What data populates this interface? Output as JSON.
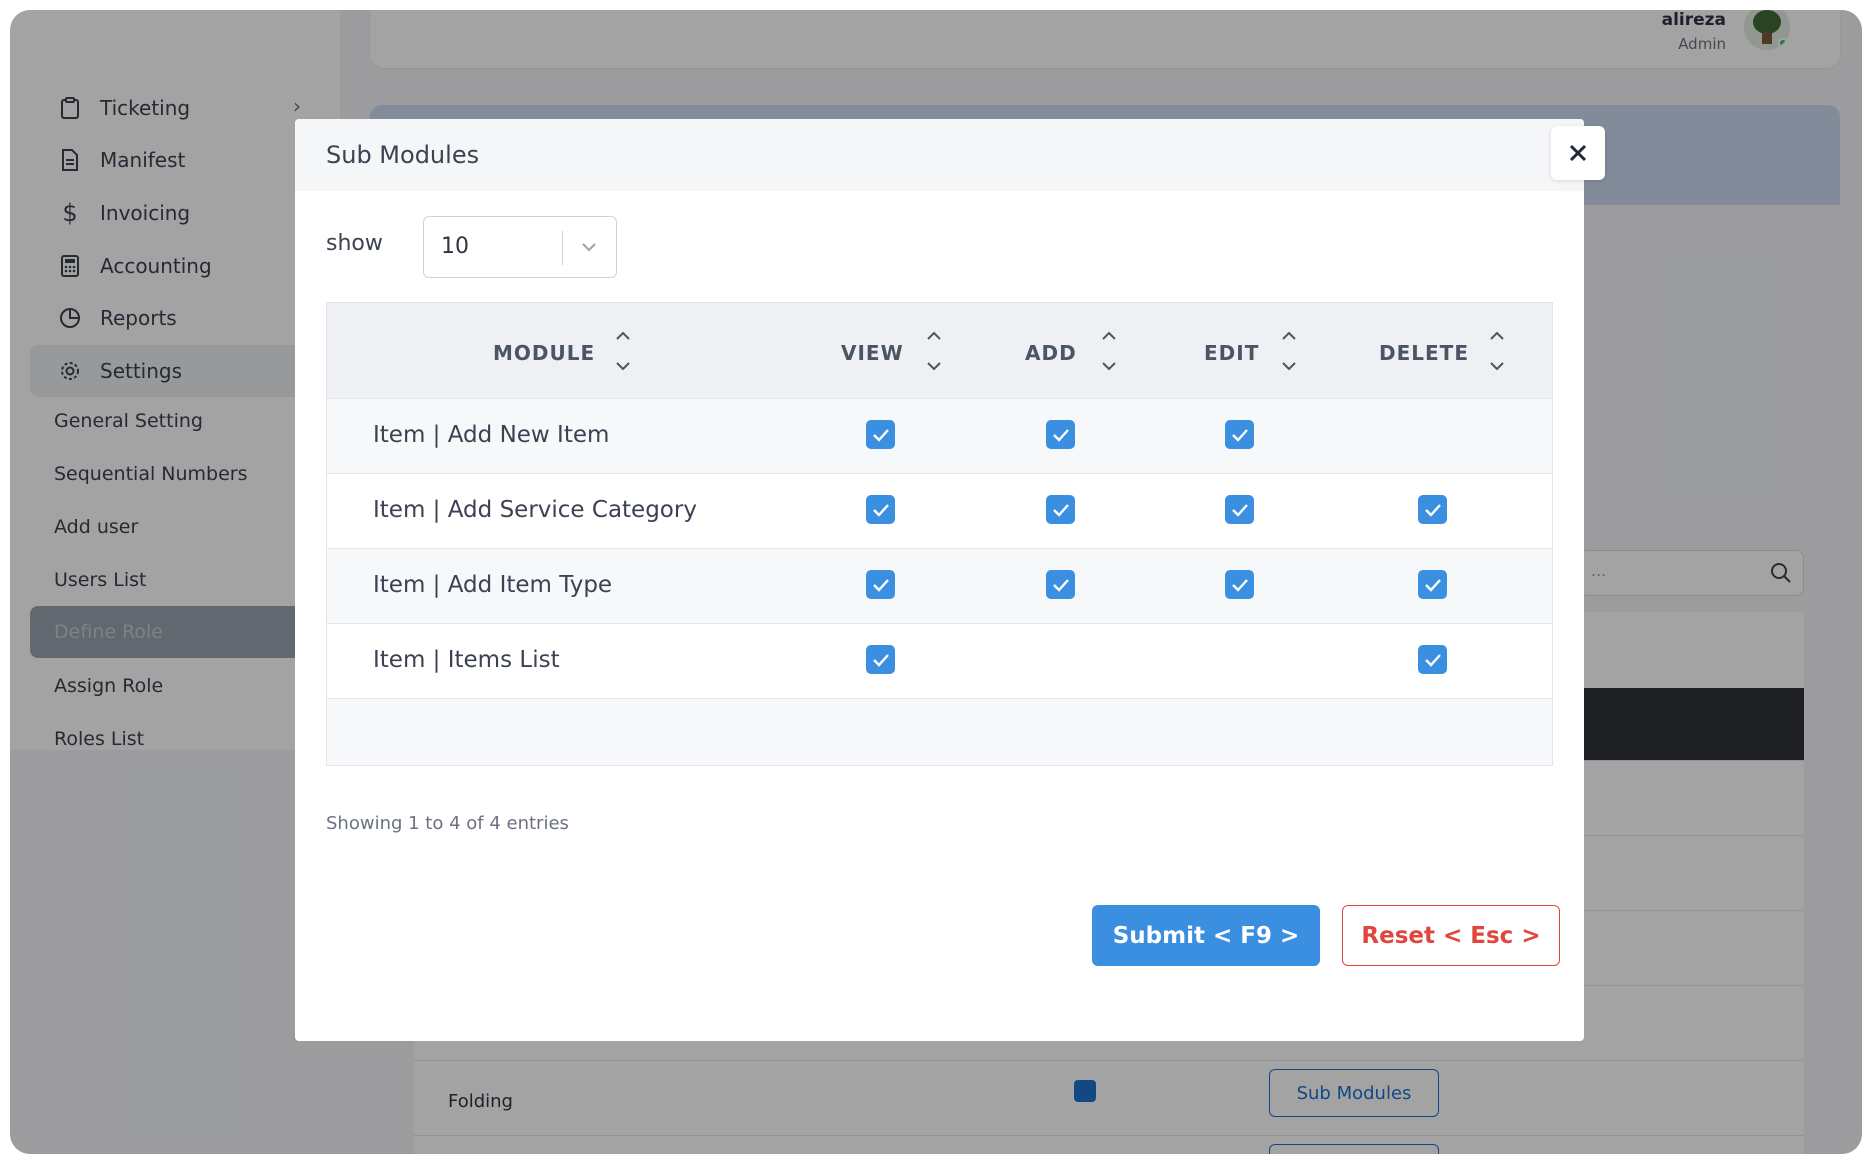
{
  "sidebar": {
    "items": [
      {
        "label": "Ticketing",
        "icon": "clipboard-icon"
      },
      {
        "label": "Manifest",
        "icon": "document-icon"
      },
      {
        "label": "Invoicing",
        "icon": "dollar-icon"
      },
      {
        "label": "Accounting",
        "icon": "calculator-icon"
      },
      {
        "label": "Reports",
        "icon": "pie-chart-icon"
      },
      {
        "label": "Settings",
        "icon": "gear-icon"
      }
    ],
    "sub_items": [
      "General Setting",
      "Sequential Numbers",
      "Add user",
      "Users List",
      "Define Role",
      "Assign Role",
      "Roles List"
    ],
    "active_sub": "Define Role"
  },
  "user": {
    "name": "alireza",
    "role": "Admin"
  },
  "background": {
    "row_label": "Folding",
    "button_label": "Sub Modules",
    "search_placeholder": "..."
  },
  "modal": {
    "title": "Sub Modules",
    "show_label": "show",
    "page_size": "10",
    "columns": [
      "MODULE",
      "VIEW",
      "ADD",
      "EDIT",
      "DELETE"
    ],
    "rows": [
      {
        "module": "Item | Add New Item",
        "view": true,
        "add": true,
        "edit": true,
        "delete": false
      },
      {
        "module": "Item | Add Service Category",
        "view": true,
        "add": true,
        "edit": true,
        "delete": true
      },
      {
        "module": "Item | Add Item Type",
        "view": true,
        "add": true,
        "edit": true,
        "delete": true
      },
      {
        "module": "Item | Items List",
        "view": true,
        "add": false,
        "edit": false,
        "delete": true
      }
    ],
    "entries_text": "Showing 1 to 4 of 4 entries",
    "submit_label": "Submit < F9 >",
    "reset_label": "Reset < Esc >"
  },
  "colors": {
    "accent": "#3b8fe0",
    "danger": "#e0463c",
    "online": "#22c55e"
  }
}
